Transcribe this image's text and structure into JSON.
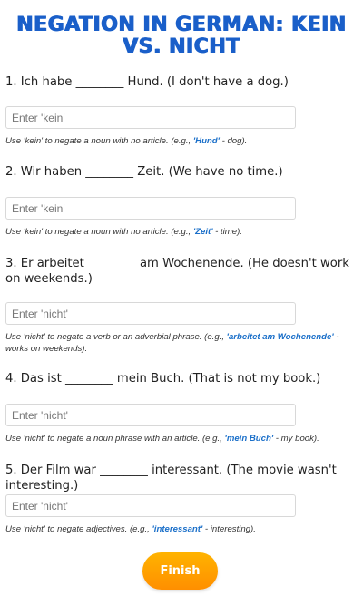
{
  "title": "Negation in German: Kein vs. Nicht",
  "questions": [
    {
      "text": "1. Ich habe ________ Hund. (I don't have a dog.)",
      "input_value": "",
      "placeholder": "Enter 'kein'",
      "hint_before": "Use 'kein' to negate a noun with no article. (e.g., ",
      "hint_example": "'Hund'",
      "hint_after": " - dog)."
    },
    {
      "text": "2. Wir haben ________ Zeit. (We have no time.)",
      "input_value": "",
      "placeholder": "Enter 'kein'",
      "hint_before": "Use 'kein' to negate a noun with no article. (e.g., ",
      "hint_example": "'Zeit'",
      "hint_after": " - time)."
    },
    {
      "text": "3. Er arbeitet ________ am Wochenende. (He doesn't work on weekends.)",
      "input_value": "",
      "placeholder": "Enter 'nicht'",
      "hint_before": "Use 'nicht' to negate a verb or an adverbial phrase. (e.g., ",
      "hint_example": "'arbeitet am Wochenende'",
      "hint_after": " - works on weekends)."
    },
    {
      "text": "4. Das ist ________ mein Buch. (That is not my book.)",
      "input_value": "",
      "placeholder": "Enter 'nicht'",
      "hint_before": "Use 'nicht' to negate a noun phrase with an article. (e.g., ",
      "hint_example": "'mein Buch'",
      "hint_after": " - my book)."
    },
    {
      "text": "5. Der Film war ________ interessant. (The movie wasn't interesting.)",
      "input_value": "",
      "placeholder": "Enter 'nicht'",
      "hint_before": "Use 'nicht' to negate adjectives. (e.g., ",
      "hint_example": "'interessant'",
      "hint_after": " - interesting)."
    }
  ],
  "finish_label": "Finish",
  "colors": {
    "title": "#1a5fc9",
    "example_highlight": "#1a6fc9",
    "button_gradient_top": "#ffb300",
    "button_gradient_bottom": "#ff8f00"
  }
}
